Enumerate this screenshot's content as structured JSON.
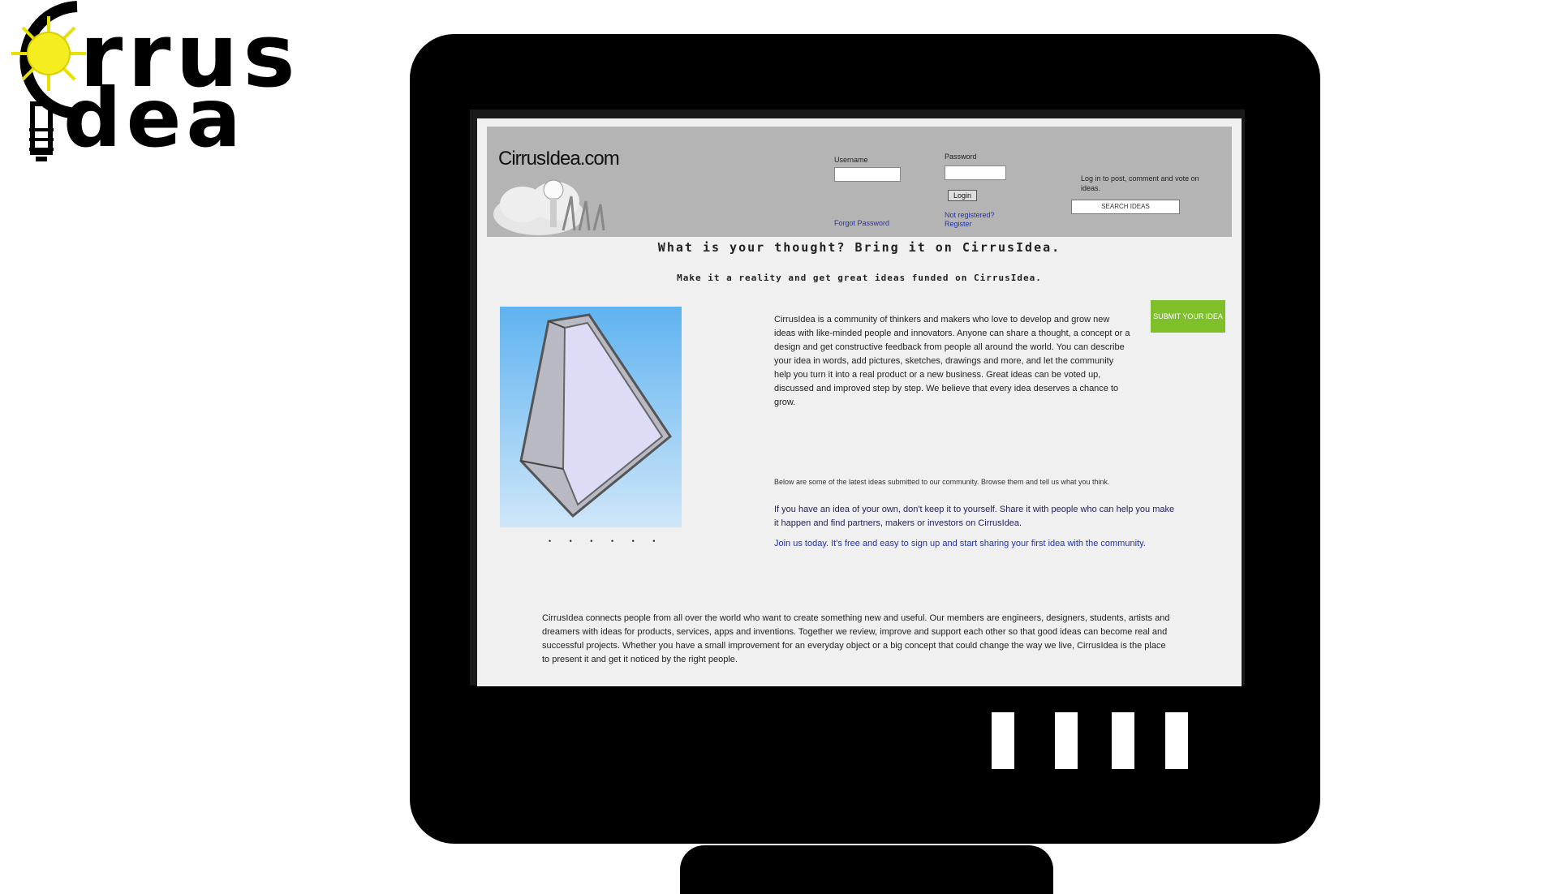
{
  "logo": {
    "line1": "rrus",
    "line2": "dea"
  },
  "website": {
    "title": "CirrusIdea.com",
    "header": {
      "username_label": "Username",
      "password_label": "Password",
      "login_button": "Login",
      "forgot_link": "Forgot Password",
      "register_link": "Not registered? Register",
      "note": "Log in to post, comment and vote on ideas.",
      "search_field": "SEARCH IDEAS"
    },
    "tagline1": "What is your thought? Bring it on CirrusIdea.",
    "tagline2": "Make it a reality and get great ideas funded on CirrusIdea.",
    "cta": "SUBMIT YOUR IDEA",
    "dots": "• • • • • •",
    "paragraph1": "CirrusIdea is a community of thinkers and makers who love to develop and grow new ideas with like-minded people and innovators. Anyone can share a thought, a concept or a design and get constructive feedback from people all around the world. You can describe your idea in words, add pictures, sketches, drawings and more, and let the community help you turn it into a real product or a new business. Great ideas can be voted up, discussed and improved step by step. We believe that every idea deserves a chance to grow.",
    "paragraph2": "Below are some of the latest ideas submitted to our community. Browse them and tell us what you think.",
    "paragraph3": "If you have an idea of your own, don't keep it to yourself. Share it with people who can help you make it happen and find partners, makers or investors on CirrusIdea.",
    "paragraph4": "Join us today. It's free and easy to sign up and start sharing your first idea with the community.",
    "paragraph5": "CirrusIdea connects people from all over the world who want to create something new and useful. Our members are engineers, designers, students, artists and dreamers with ideas for products, services, apps and inventions. Together we review, improve and support each other so that good ideas can become real and successful projects. Whether you have a small improvement for an everyday object or a big concept that could change the way we live, CirrusIdea is the place to present it and get it noticed by the right people."
  }
}
